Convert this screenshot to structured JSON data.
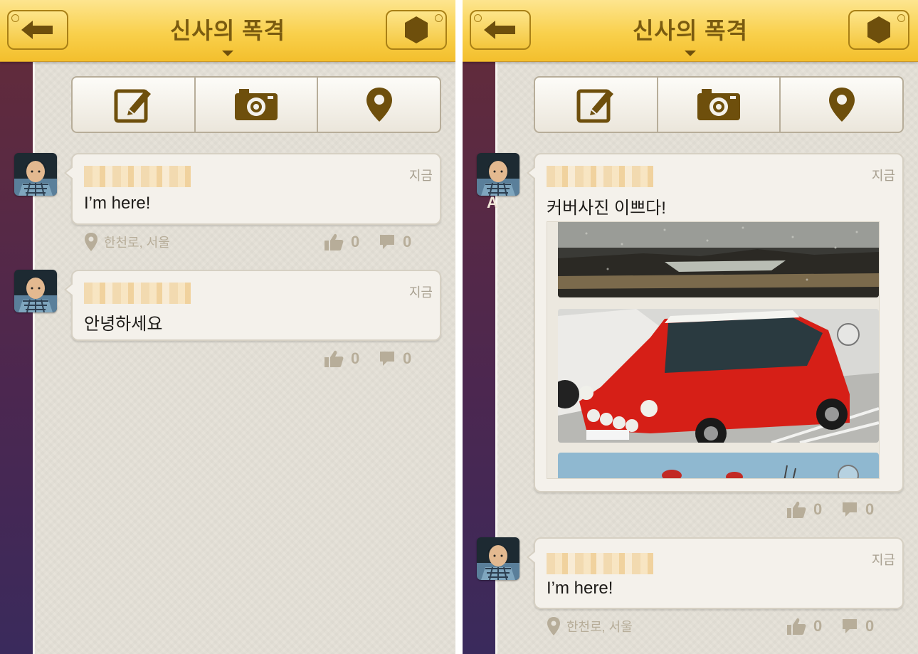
{
  "screens": [
    {
      "header": {
        "title": "신사의 폭격"
      },
      "posts": [
        {
          "time": "지금",
          "text": "I’m here!",
          "location": "한천로, 서울",
          "likes": "0",
          "comments": "0"
        },
        {
          "time": "지금",
          "text": "안녕하세요",
          "likes": "0",
          "comments": "0"
        }
      ]
    },
    {
      "header": {
        "title": "신사의 폭격"
      },
      "stray_letter": "A",
      "posts": [
        {
          "time": "지금",
          "text": "커버사진 이쁘다!",
          "likes": "0",
          "comments": "0"
        },
        {
          "time": "지금",
          "text": "I’m here!",
          "location": "한천로, 서울",
          "likes": "0",
          "comments": "0"
        }
      ]
    }
  ],
  "icons": {
    "back": "back-arrow-icon",
    "menu": "hexagon-menu-icon",
    "write": "pencil-edit-icon",
    "camera": "camera-icon",
    "location": "location-pin-icon",
    "like": "thumbs-up-icon",
    "comment": "speech-bubble-icon"
  },
  "colors": {
    "header_yellow": "#f9d04c",
    "icon_brown": "#6e4f0c",
    "muted_text": "#b7ad99",
    "background": "#e6e2d9"
  }
}
